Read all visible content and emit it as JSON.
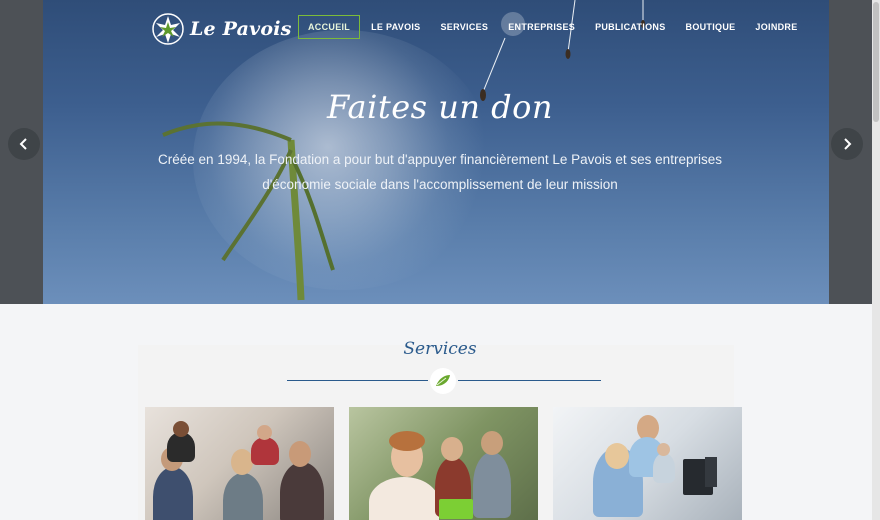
{
  "site": {
    "logo_text": "Le Pavois",
    "nav": [
      {
        "label": "ACCUEIL",
        "active": true
      },
      {
        "label": "LE PAVOIS"
      },
      {
        "label": "SERVICES"
      },
      {
        "label": "ENTREPRISES"
      },
      {
        "label": "PUBLICATIONS"
      },
      {
        "label": "BOUTIQUE"
      },
      {
        "label": "JOINDRE"
      }
    ]
  },
  "hero": {
    "title": "Faites un don",
    "subtitle_line1": "Créée en 1994, la Fondation a pour but d'appuyer financièrement Le Pavois et ses entreprises",
    "subtitle_line2": "d'économie sociale dans l'accomplissement de leur mission",
    "prev_icon": "chevron-left-icon",
    "next_icon": "chevron-right-icon"
  },
  "services": {
    "title": "Services",
    "divider_icon": "leaf-icon"
  },
  "colors": {
    "accent": "#7cbb3a",
    "heading_blue": "#2a5a8c",
    "hero_sky": "#3d5f8f"
  }
}
